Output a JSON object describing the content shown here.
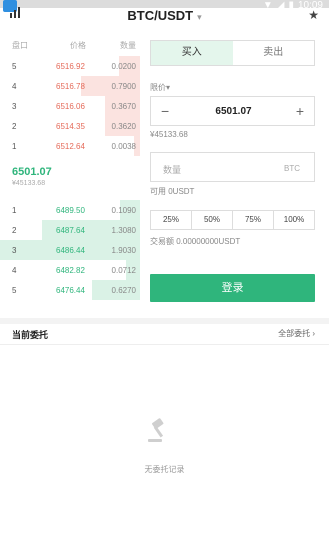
{
  "status_bar": {
    "time": "10:09"
  },
  "header": {
    "pair": "BTC/USDT"
  },
  "orderbook": {
    "col_index": "盘口",
    "col_price": "价格",
    "col_qty": "数量",
    "asks": [
      {
        "idx": "5",
        "price": "6516.92",
        "qty": "0.0200",
        "depth": 0.15
      },
      {
        "idx": "4",
        "price": "6516.78",
        "qty": "0.7900",
        "depth": 0.42
      },
      {
        "idx": "3",
        "price": "6516.06",
        "qty": "0.3670",
        "depth": 0.25
      },
      {
        "idx": "2",
        "price": "6514.35",
        "qty": "0.3620",
        "depth": 0.25
      },
      {
        "idx": "1",
        "price": "6512.64",
        "qty": "0.0038",
        "depth": 0.04
      }
    ],
    "last_price": "6501.07",
    "last_price_cny": "¥45133.68",
    "bids": [
      {
        "idx": "1",
        "price": "6489.50",
        "qty": "0.1090",
        "depth": 0.14
      },
      {
        "idx": "2",
        "price": "6487.64",
        "qty": "1.3080",
        "depth": 0.7
      },
      {
        "idx": "3",
        "price": "6486.44",
        "qty": "1.9030",
        "depth": 1.0
      },
      {
        "idx": "4",
        "price": "6482.82",
        "qty": "0.0712",
        "depth": 0.1
      },
      {
        "idx": "5",
        "price": "6476.44",
        "qty": "0.6270",
        "depth": 0.34
      }
    ]
  },
  "trade": {
    "buy_tab": "买入",
    "sell_tab": "卖出",
    "price_label": "限价",
    "price_value": "6501.07",
    "price_cny": "¥45133.68",
    "qty_placeholder": "数量",
    "qty_unit": "BTC",
    "available": "可用 0USDT",
    "percents": [
      "25%",
      "50%",
      "75%",
      "100%"
    ],
    "turnover": "交易额 0.00000000USDT",
    "submit": "登录"
  },
  "orders": {
    "title": "当前委托",
    "view_all": "全部委托",
    "empty": "无委托记录"
  },
  "colors": {
    "accent": "#2fb57c",
    "ask": "#e56b5a"
  }
}
